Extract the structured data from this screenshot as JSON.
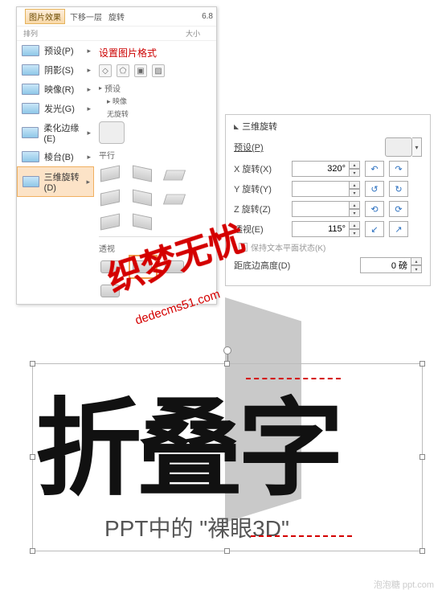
{
  "ribbon": {
    "dropdown_btn": "图片效果",
    "toolbar_items": [
      "下移一层",
      "旋转"
    ],
    "size_value": "6.8",
    "subhead": {
      "a": "排列",
      "b": "大小"
    },
    "menu": [
      {
        "label": "预设(P)"
      },
      {
        "label": "阴影(S)"
      },
      {
        "label": "映像(R)"
      },
      {
        "label": "发光(G)"
      },
      {
        "label": "柔化边缘(E)"
      },
      {
        "label": "棱台(B)"
      },
      {
        "label": "三维旋转(D)"
      }
    ],
    "gallery_title": "设置图片格式",
    "section_preset": "预设",
    "section_sub": "▸ 映像",
    "none_label": "无旋转",
    "section_parallel": "平行",
    "section_perspective": "透视"
  },
  "rotation": {
    "title": "三维旋转",
    "preset_label": "预设(P)",
    "rows": [
      {
        "label": "X 旋转(X)",
        "value": "320°"
      },
      {
        "label": "Y 旋转(Y)",
        "value": ""
      },
      {
        "label": "Z 旋转(Z)",
        "value": ""
      },
      {
        "label": "透视(E)",
        "value": "115°"
      }
    ],
    "keep_flat": "保持文本平面状态(K)",
    "distance_label": "距底边高度(D)",
    "distance_value": "0 磅"
  },
  "canvas": {
    "big_text": "折叠字",
    "sub_text": "PPT中的 \"裸眼3D\""
  },
  "overlay": {
    "script": "织梦无忧",
    "url": "dedecms51.com"
  },
  "credit": "泡泡糖 ppt.com"
}
